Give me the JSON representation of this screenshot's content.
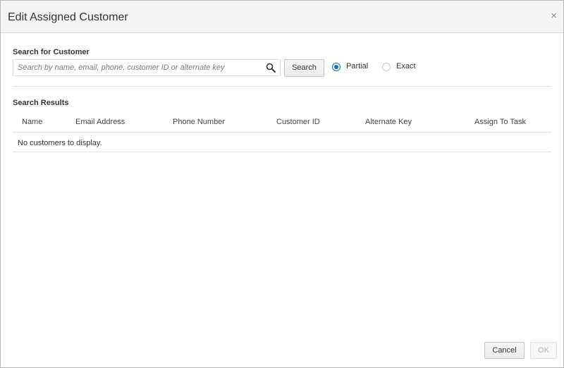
{
  "dialog": {
    "title": "Edit Assigned Customer",
    "close_glyph": "×"
  },
  "search": {
    "label": "Search for Customer",
    "placeholder": "Search by name, email, phone, customer ID or alternate key",
    "value": "",
    "icon": "search-icon",
    "button_label": "Search",
    "match_options": [
      {
        "label": "Partial",
        "selected": true
      },
      {
        "label": "Exact",
        "selected": false
      }
    ]
  },
  "results": {
    "label": "Search Results",
    "columns": [
      "Name",
      "Email Address",
      "Phone Number",
      "Customer ID",
      "Alternate Key",
      "Assign To Task"
    ],
    "rows": [],
    "empty_message": "No customers to display."
  },
  "footer": {
    "cancel_label": "Cancel",
    "ok_label": "OK",
    "ok_enabled": false
  },
  "colors": {
    "accent": "#0a72c7",
    "header_bg": "#f4f4f4"
  }
}
